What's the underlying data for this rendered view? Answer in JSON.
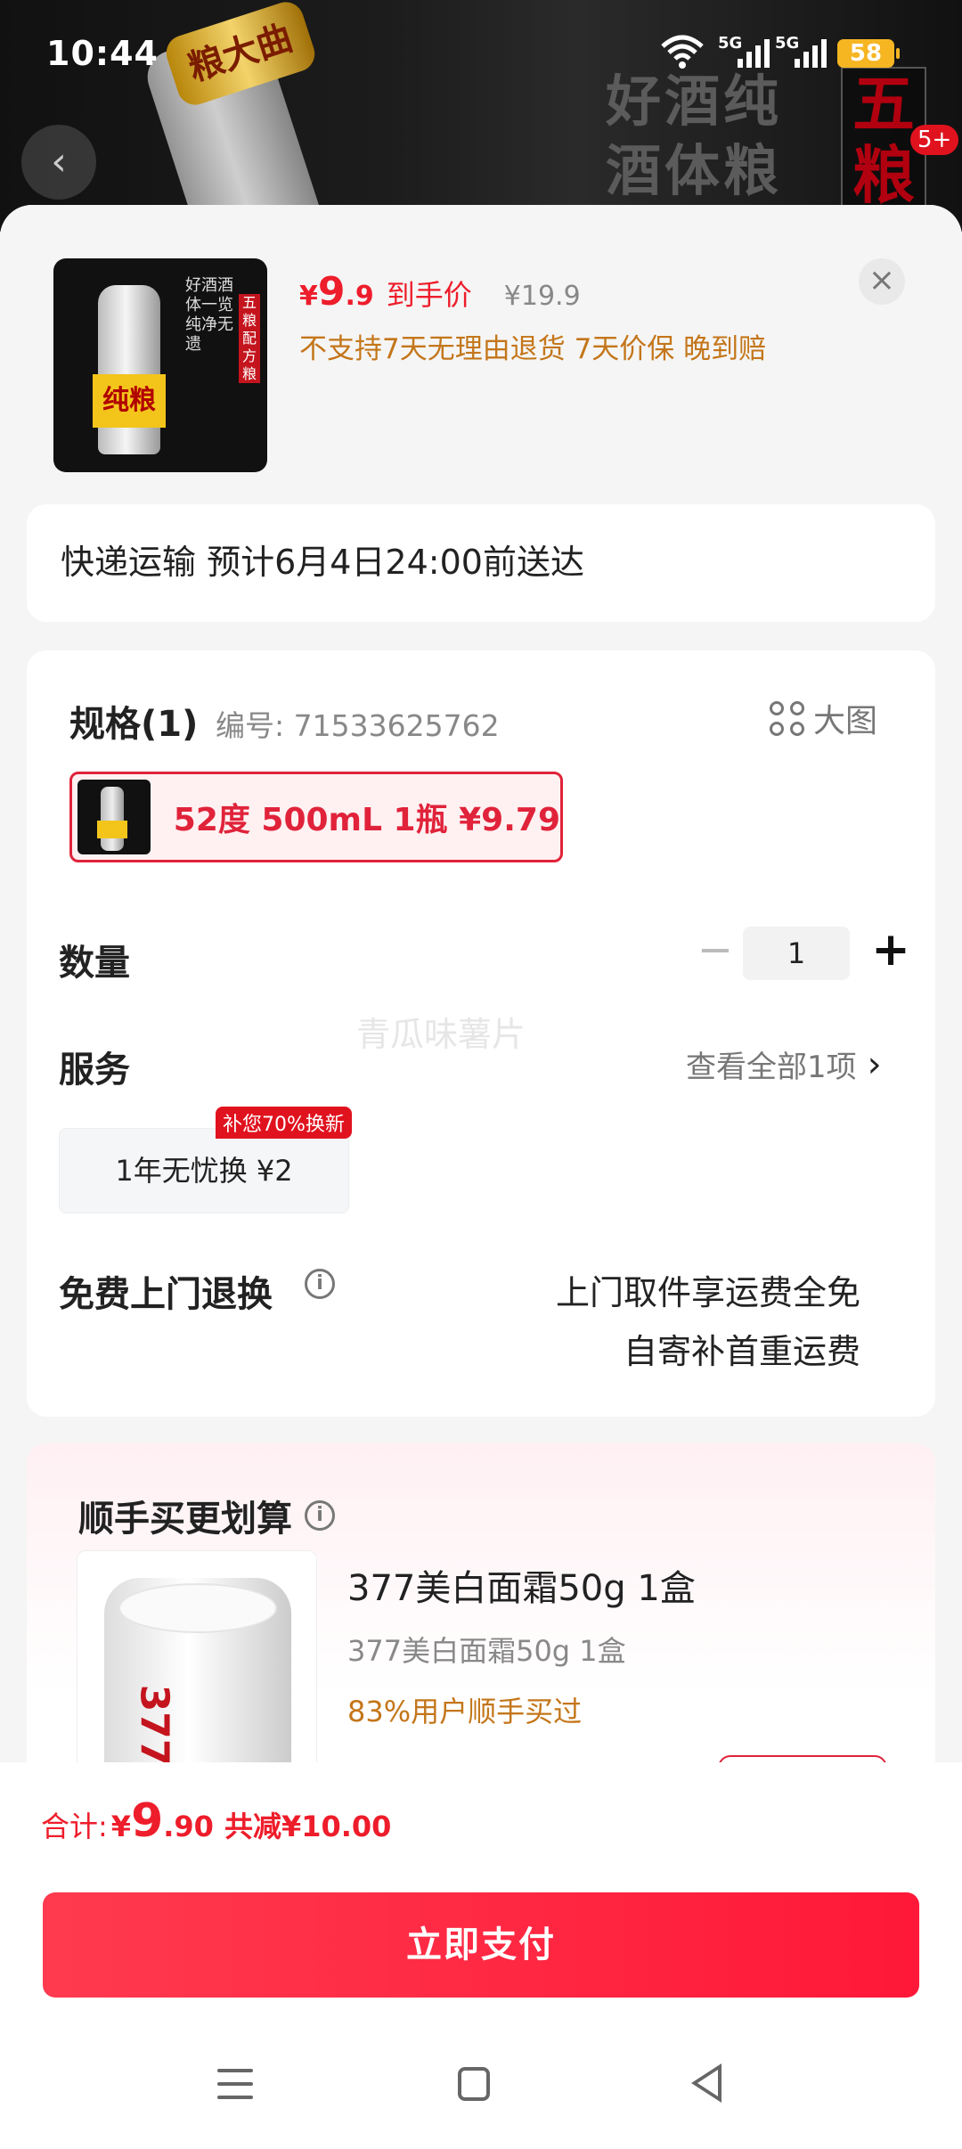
{
  "status": {
    "time": "10:44",
    "sig1": "5G",
    "sig2": "5G",
    "battery": "58"
  },
  "background": {
    "chars": "好酒纯酒体粮",
    "red_text": "五粮",
    "badge": "5+",
    "cap_text": "粮大曲"
  },
  "product": {
    "thumb_label": "纯粮",
    "thumb_text": "好酒酒体一览纯净无遗",
    "thumb_red": "五粮配方粮",
    "price_currency": "¥",
    "price_int": "9",
    "price_dec": ".9",
    "price_tag": "到手价",
    "price_orig": "¥19.9",
    "policy": "不支持7天无理由退货  7天价保  晚到赔",
    "close": "×"
  },
  "shipping": {
    "text": "快递运输 预计6月4日24:00前送达"
  },
  "spec": {
    "title": "规格(1)",
    "code": "编号: 71533625762",
    "big_pic": "大图",
    "variant_label": "52度 500mL 1瓶  ¥9.79",
    "qty_label": "数量",
    "qty_minus": "−",
    "qty_value": "1",
    "qty_plus": "+",
    "service_label": "服务",
    "service_all": "查看全部1项",
    "service_chev": "›",
    "watermark": "青瓜味薯片",
    "service_option": "1年无忧换  ¥2",
    "service_badge": "补您70%换新",
    "return_label": "免费上门退换",
    "return_line1": "上门取件享运费全免",
    "return_line2": "自寄补首重运费"
  },
  "upsell": {
    "title": "顺手买更划算",
    "name": "377美白面霜50g 1盒",
    "sub": "377美白面霜50g 1盒",
    "pct": "83%用户顺手买过",
    "jar_num": "377"
  },
  "footer": {
    "total_label": "合计:",
    "total_cur": "¥",
    "total_int": "9",
    "total_dec": ".90",
    "total_save": "共减¥10.00",
    "pay_label": "立即支付"
  }
}
